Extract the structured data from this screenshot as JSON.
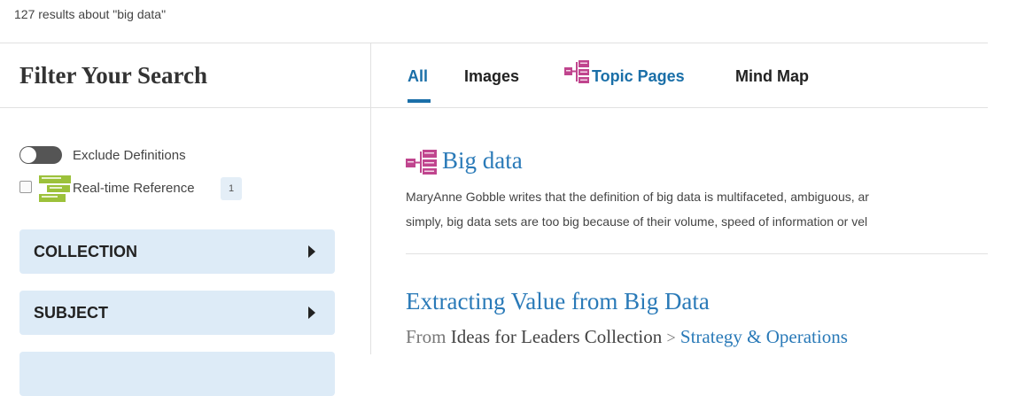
{
  "results_summary": "127 results about \"big data\"",
  "filter": {
    "title": "Filter Your Search",
    "exclude_definitions_label": "Exclude Definitions",
    "realtime_reference": {
      "label": "Real-time Reference",
      "count": "1"
    },
    "facets": [
      {
        "label": "COLLECTION"
      },
      {
        "label": "SUBJECT"
      }
    ]
  },
  "tabs": [
    {
      "label": "All",
      "active": true
    },
    {
      "label": "Images"
    },
    {
      "label": "Topic Pages",
      "icon": "topic-page-icon"
    },
    {
      "label": "Mind Map"
    }
  ],
  "results": [
    {
      "title": "Big data",
      "icon": "topic-page-icon",
      "snippet_lines": [
        "MaryAnne Gobble writes that the definition of big data is multifaceted, ambiguous, ar",
        "simply, big data sets are too big because of their volume, speed of information or vel"
      ]
    },
    {
      "title": "Extracting Value from Big Data",
      "from_label": "From",
      "source": "Ideas for Leaders Collection",
      "separator": ">",
      "category": "Strategy & Operations"
    }
  ],
  "colors": {
    "accent": "#2a7ab8",
    "facet_bg": "#ddebf7",
    "topic_icon": "#c0458e",
    "realtime_icon": "#9cc13a"
  }
}
